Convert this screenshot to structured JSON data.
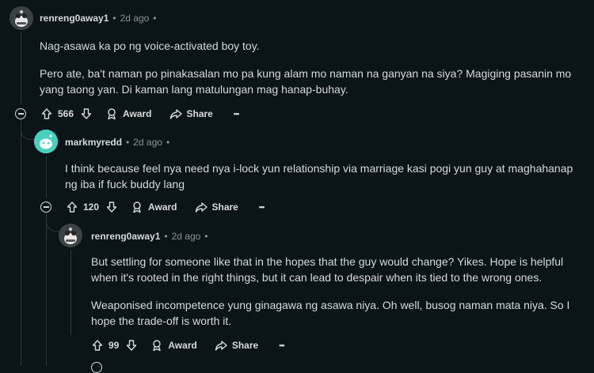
{
  "comments": [
    {
      "username": "renreng0away1",
      "time": "2d ago",
      "paragraphs": [
        "Nag-asawa ka po ng voice-activated boy toy.",
        "Pero ate, ba't naman po pinakasalan mo pa kung alam mo naman na ganyan na siya? Magiging pasanin mo yang taong yan. Di kaman lang matulungan mag hanap-buhay."
      ],
      "votes": "566",
      "award_label": "Award",
      "share_label": "Share",
      "more_label": "•••"
    },
    {
      "username": "markmyredd",
      "time": "2d ago",
      "paragraphs": [
        "I think because feel nya need nya i-lock yun relationship via marriage kasi pogi yun guy at maghahanap ng iba if fuck buddy lang"
      ],
      "votes": "120",
      "award_label": "Award",
      "share_label": "Share",
      "more_label": "•••"
    },
    {
      "username": "renreng0away1",
      "time": "2d ago",
      "paragraphs": [
        "But settling for someone like that in the hopes that the guy would change? Yikes. Hope is helpful when it's rooted in the right things, but it can lead to despair when its tied to the wrong ones.",
        "Weaponised incompetence yung ginagawa ng asawa niya. Oh well, busog naman mata niya. So I hope the trade-off is worth it."
      ],
      "votes": "99",
      "award_label": "Award",
      "share_label": "Share",
      "more_label": "•••"
    }
  ],
  "colors": {
    "background": "#0b1416",
    "text": "#d7dadc",
    "muted": "#8c9498",
    "thread_line": "#343536",
    "avatar_teal": "#46d1be"
  }
}
